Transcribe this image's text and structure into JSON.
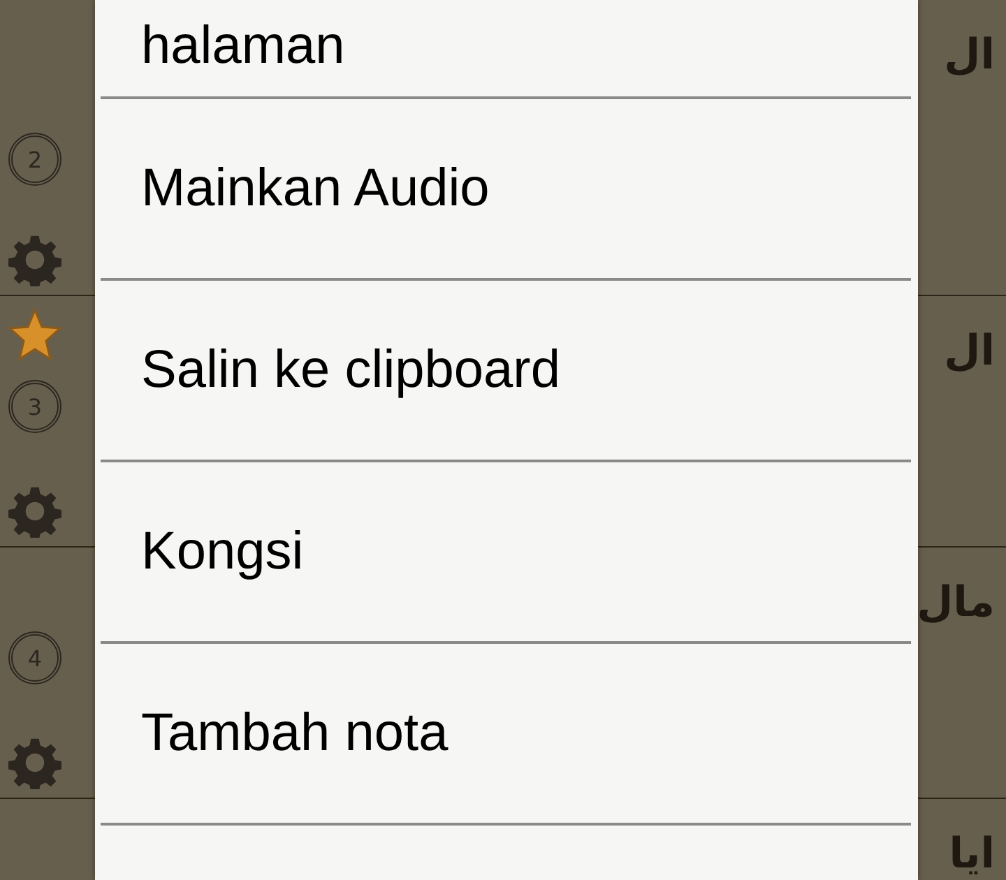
{
  "verses": [
    {
      "number": "2",
      "bookmarked": false,
      "arabic": "ال"
    },
    {
      "number": "3",
      "bookmarked": true,
      "arabic": "ال"
    },
    {
      "number": "4",
      "bookmarked": false,
      "arabic": "مال"
    },
    {
      "arabic": "ايا"
    }
  ],
  "menu": {
    "items": [
      {
        "label": "halaman"
      },
      {
        "label": "Mainkan Audio"
      },
      {
        "label": "Salin ke clipboard"
      },
      {
        "label": "Kongsi"
      },
      {
        "label": "Tambah nota"
      }
    ]
  }
}
